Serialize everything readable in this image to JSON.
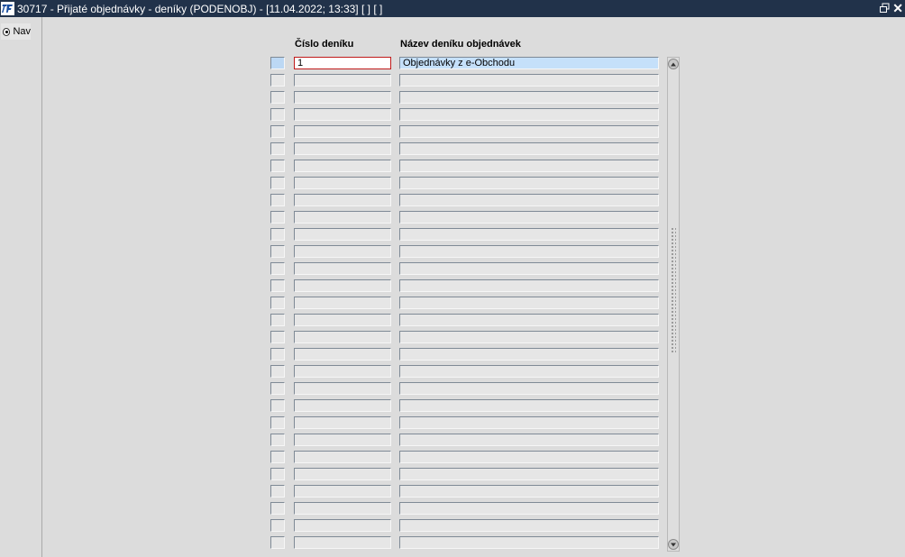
{
  "window": {
    "title": "30717 - Přijaté objednávky - deníky (PODENOBJ) - [11.04.2022; 13:33]  [ ]  [ ]"
  },
  "nav": {
    "label": "Nav"
  },
  "columns": {
    "cislo": "Číslo deníku",
    "nazev": "Název deníku objednávek"
  },
  "rows": [
    {
      "cislo": "1",
      "nazev": "Objednávky z e-Obchodu"
    },
    {
      "cislo": "",
      "nazev": ""
    },
    {
      "cislo": "",
      "nazev": ""
    },
    {
      "cislo": "",
      "nazev": ""
    },
    {
      "cislo": "",
      "nazev": ""
    },
    {
      "cislo": "",
      "nazev": ""
    },
    {
      "cislo": "",
      "nazev": ""
    },
    {
      "cislo": "",
      "nazev": ""
    },
    {
      "cislo": "",
      "nazev": ""
    },
    {
      "cislo": "",
      "nazev": ""
    },
    {
      "cislo": "",
      "nazev": ""
    },
    {
      "cislo": "",
      "nazev": ""
    },
    {
      "cislo": "",
      "nazev": ""
    },
    {
      "cislo": "",
      "nazev": ""
    },
    {
      "cislo": "",
      "nazev": ""
    },
    {
      "cislo": "",
      "nazev": ""
    },
    {
      "cislo": "",
      "nazev": ""
    },
    {
      "cislo": "",
      "nazev": ""
    },
    {
      "cislo": "",
      "nazev": ""
    },
    {
      "cislo": "",
      "nazev": ""
    },
    {
      "cislo": "",
      "nazev": ""
    },
    {
      "cislo": "",
      "nazev": ""
    },
    {
      "cislo": "",
      "nazev": ""
    },
    {
      "cislo": "",
      "nazev": ""
    },
    {
      "cislo": "",
      "nazev": ""
    },
    {
      "cislo": "",
      "nazev": ""
    },
    {
      "cislo": "",
      "nazev": ""
    },
    {
      "cislo": "",
      "nazev": ""
    },
    {
      "cislo": "",
      "nazev": ""
    }
  ],
  "colors": {
    "titlebar": "#21324a",
    "current_row": "#c5e0fa",
    "focus_border": "#c01a1a"
  }
}
